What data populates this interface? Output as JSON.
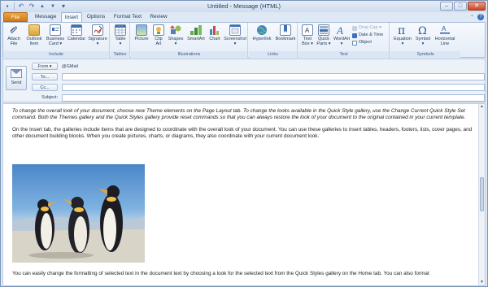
{
  "window": {
    "title": "Untitled - Message (HTML)",
    "ctrl_min": "–",
    "ctrl_max": "□",
    "ctrl_close": "✕"
  },
  "quick_access": {
    "icons": [
      "save-icon",
      "undo-icon",
      "redo-icon",
      "up-arrow-icon",
      "down-arrow-icon"
    ],
    "save_glyph": "▪",
    "undo_glyph": "↶",
    "redo_glyph": "↷",
    "up_glyph": "▲",
    "down_glyph": "▼",
    "more_glyph": "▾"
  },
  "tabs": {
    "file": "File",
    "message": "Message",
    "insert": "Insert",
    "options": "Options",
    "format_text": "Format Text",
    "review": "Review",
    "help_glyph": "?",
    "caret_glyph": "⌃"
  },
  "ribbon": {
    "include": {
      "label": "Include",
      "attach_file": "Attach\nFile",
      "outlook_item": "Outlook\nItem",
      "business_card": "Business\nCard ▾",
      "calendar": "Calendar",
      "signature": "Signature\n▾"
    },
    "tables": {
      "label": "Tables",
      "table": "Table\n▾"
    },
    "illustrations": {
      "label": "Illustrations",
      "picture": "Picture",
      "clip_art": "Clip\nArt",
      "shapes": "Shapes\n▾",
      "smartart": "SmartArt",
      "chart": "Chart",
      "screenshot": "Screenshot\n▾"
    },
    "links": {
      "label": "Links",
      "hyperlink": "Hyperlink",
      "bookmark": "Bookmark"
    },
    "text": {
      "label": "Text",
      "text_box": "Text\nBox ▾",
      "quick_parts": "Quick\nParts ▾",
      "wordart": "WordArt\n▾",
      "drop_cap": "Drop Cap ▾",
      "date_time": "Date & Time",
      "object": "Object"
    },
    "symbols": {
      "label": "Symbols",
      "equation": "Equation\n▾",
      "symbol": "Symbol\n▾",
      "horizontal_line": "Horizontal\nLine"
    }
  },
  "header": {
    "send": "Send",
    "from_button": "From ▾",
    "from_value": "@GMail",
    "to_button": "To...",
    "cc_button": "Cc...",
    "subject_label": "Subject:",
    "to_value": "",
    "cc_value": "",
    "subject_value": ""
  },
  "body": {
    "paragraph1": "To change the overall look of your document, choose new Theme elements on the Page Layout tab. To change the looks available in the Quick Style gallery, use the Change Current Quick Style Set command. Both the Themes gallery and the Quick Styles gallery provide reset commands so that you can always restore the look of your document to the original contained in your current template.",
    "paragraph2": "On the Insert tab, the galleries include items that are designed to coordinate with the overall look of your document. You can use these galleries to insert tables, headers, footers, lists, cover pages, and other document building blocks. When you create pictures, charts, or diagrams, they also coordinate with your current document look.",
    "paragraph3": "You can easily change the formatting of selected text in the document text by choosing a look for the selected text from the Quick Styles gallery on the Home tab. You can also format",
    "scroll_up": "▲",
    "scroll_down": "▼"
  }
}
